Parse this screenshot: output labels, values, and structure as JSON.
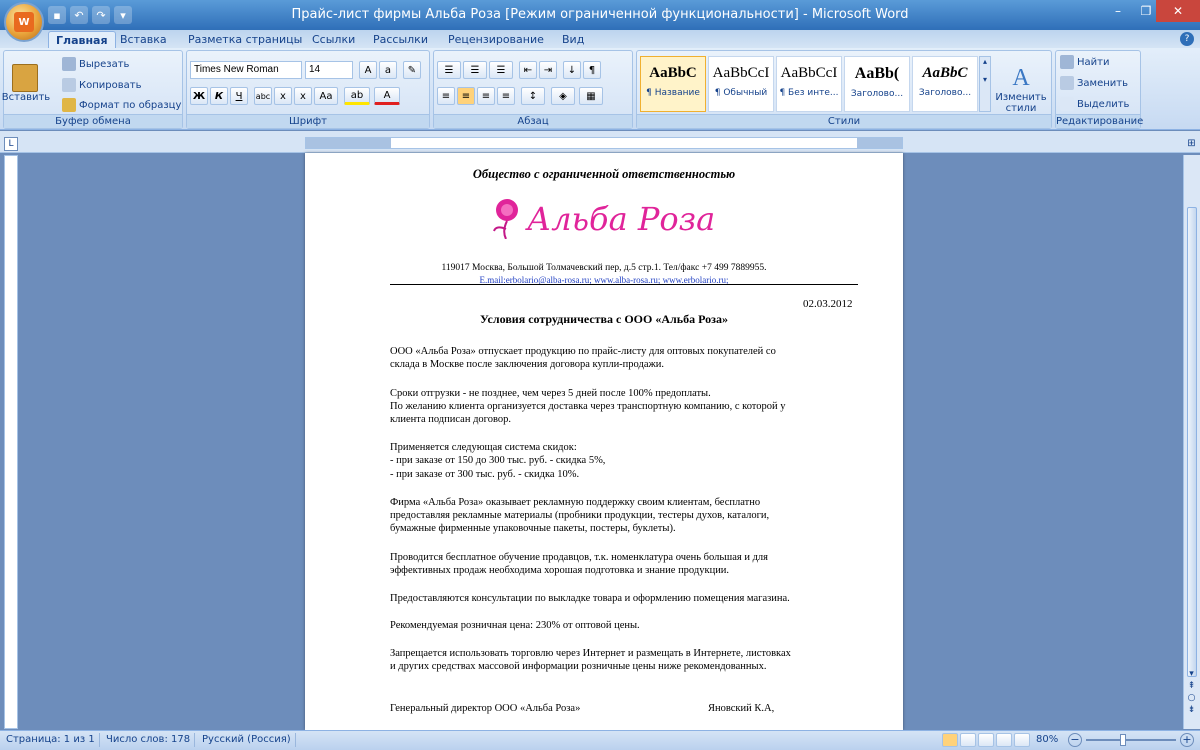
{
  "window": {
    "title": "Прайс-лист фирмы Альба Роза [Режим ограниченной функциональности] - Microsoft Word",
    "qat": [
      "save-icon",
      "undo-icon",
      "redo-icon",
      "customize-icon"
    ],
    "controls": {
      "minimize": "–",
      "restore": "❐",
      "close": "✕"
    }
  },
  "tabs": [
    "Главная",
    "Вставка",
    "Разметка страницы",
    "Ссылки",
    "Рассылки",
    "Рецензирование",
    "Вид"
  ],
  "ribbon": {
    "clipboard": {
      "label": "Буфер обмена",
      "paste": "Вставить",
      "cut": "Вырезать",
      "copy": "Копировать",
      "format": "Формат по образцу"
    },
    "font": {
      "label": "Шрифт",
      "name": "Times New Roman",
      "size": "14"
    },
    "paragraph": {
      "label": "Абзац"
    },
    "styles": {
      "label": "Стили",
      "items": [
        {
          "sample": "AaBbC",
          "name": "¶ Название"
        },
        {
          "sample": "AaBbCcI",
          "name": "¶ Обычный"
        },
        {
          "sample": "AaBbCcI",
          "name": "¶ Без инте..."
        },
        {
          "sample": "AaBb(",
          "name": "Заголово..."
        },
        {
          "sample": "AaBbC",
          "name": "Заголово..."
        }
      ],
      "change": "Изменить стили"
    },
    "editing": {
      "label": "Редактирование",
      "find": "Найти",
      "replace": "Заменить",
      "select": "Выделить"
    }
  },
  "document": {
    "org": "Общество с ограниченной ответственностью",
    "logo_text": "Альба Роза",
    "address": "119017 Москва, Большой Толмачевский пер, д.5 стр.1. Тел/факс +7 499 7889955.",
    "email": "E.mail:erbolario@alba-rosa.ru; www.alba-rosa.ru; www.erbolario.ru;",
    "date": "02.03.2012",
    "heading": "Условия сотрудничества с ООО «Альба Роза»",
    "lines": [
      "ООО «Альба Роза» отпускает продукцию по прайс-листу для оптовых покупателей со",
      "склада в Москве после заключения договора купли-продажи.",
      "Сроки отгрузки - не позднее, чем через 5 дней после  100% предоплаты.",
      "По желанию клиента организуется доставка через транспортную компанию, с которой у",
      "клиента подписан договор.",
      "Применяется следующая система скидок:",
      "- при заказе от 150 до 300 тыс. руб. - скидка 5%,",
      "- при заказе от 300 тыс. руб. - скидка 10%.",
      "Фирма «Альба Роза» оказывает рекламную поддержку своим клиентам,  бесплатно",
      "предоставляя рекламные материалы (пробники продукции, тестеры духов, каталоги,",
      "бумажные фирменные упаковочные пакеты, постеры, буклеты).",
      "Проводится  бесплатное обучение продавцов, т.к. номенклатура очень большая и для",
      "эффективных продаж необходима хорошая подготовка и знание продукции.",
      "Предоставляются  консультации по выкладке товара и оформлению помещения магазина.",
      "Рекомендуемая розничная цена: 230% от оптовой цены.",
      "Запрещается использовать торговлю через Интернет и размещать в Интернете, листовках",
      "и других средствах массовой информации розничные цены ниже рекомендованных."
    ],
    "signer_title": "Генеральный директор ООО «Альба Роза»",
    "signer_name": "Яновский К.А,"
  },
  "status": {
    "page": "Страница: 1 из 1",
    "words": "Число слов: 178",
    "lang": "Русский (Россия)",
    "zoom": "80%"
  },
  "colors": {
    "accent": "#2f6fb8",
    "logo": "#e0249a"
  }
}
